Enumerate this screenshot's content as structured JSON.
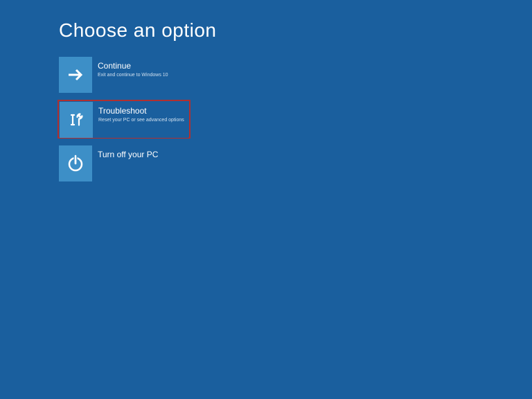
{
  "page": {
    "title": "Choose an option"
  },
  "options": [
    {
      "title": "Continue",
      "subtitle": "Exit and continue to Windows 10",
      "icon": "arrow-right",
      "highlighted": false
    },
    {
      "title": "Troubleshoot",
      "subtitle": "Reset your PC or see advanced options",
      "icon": "tools",
      "highlighted": true
    },
    {
      "title": "Turn off your PC",
      "subtitle": "",
      "icon": "power",
      "highlighted": false
    }
  ],
  "colors": {
    "background": "#1a5f9e",
    "tile_icon_bg": "#3d8fc7",
    "highlight_border": "#b03030"
  }
}
